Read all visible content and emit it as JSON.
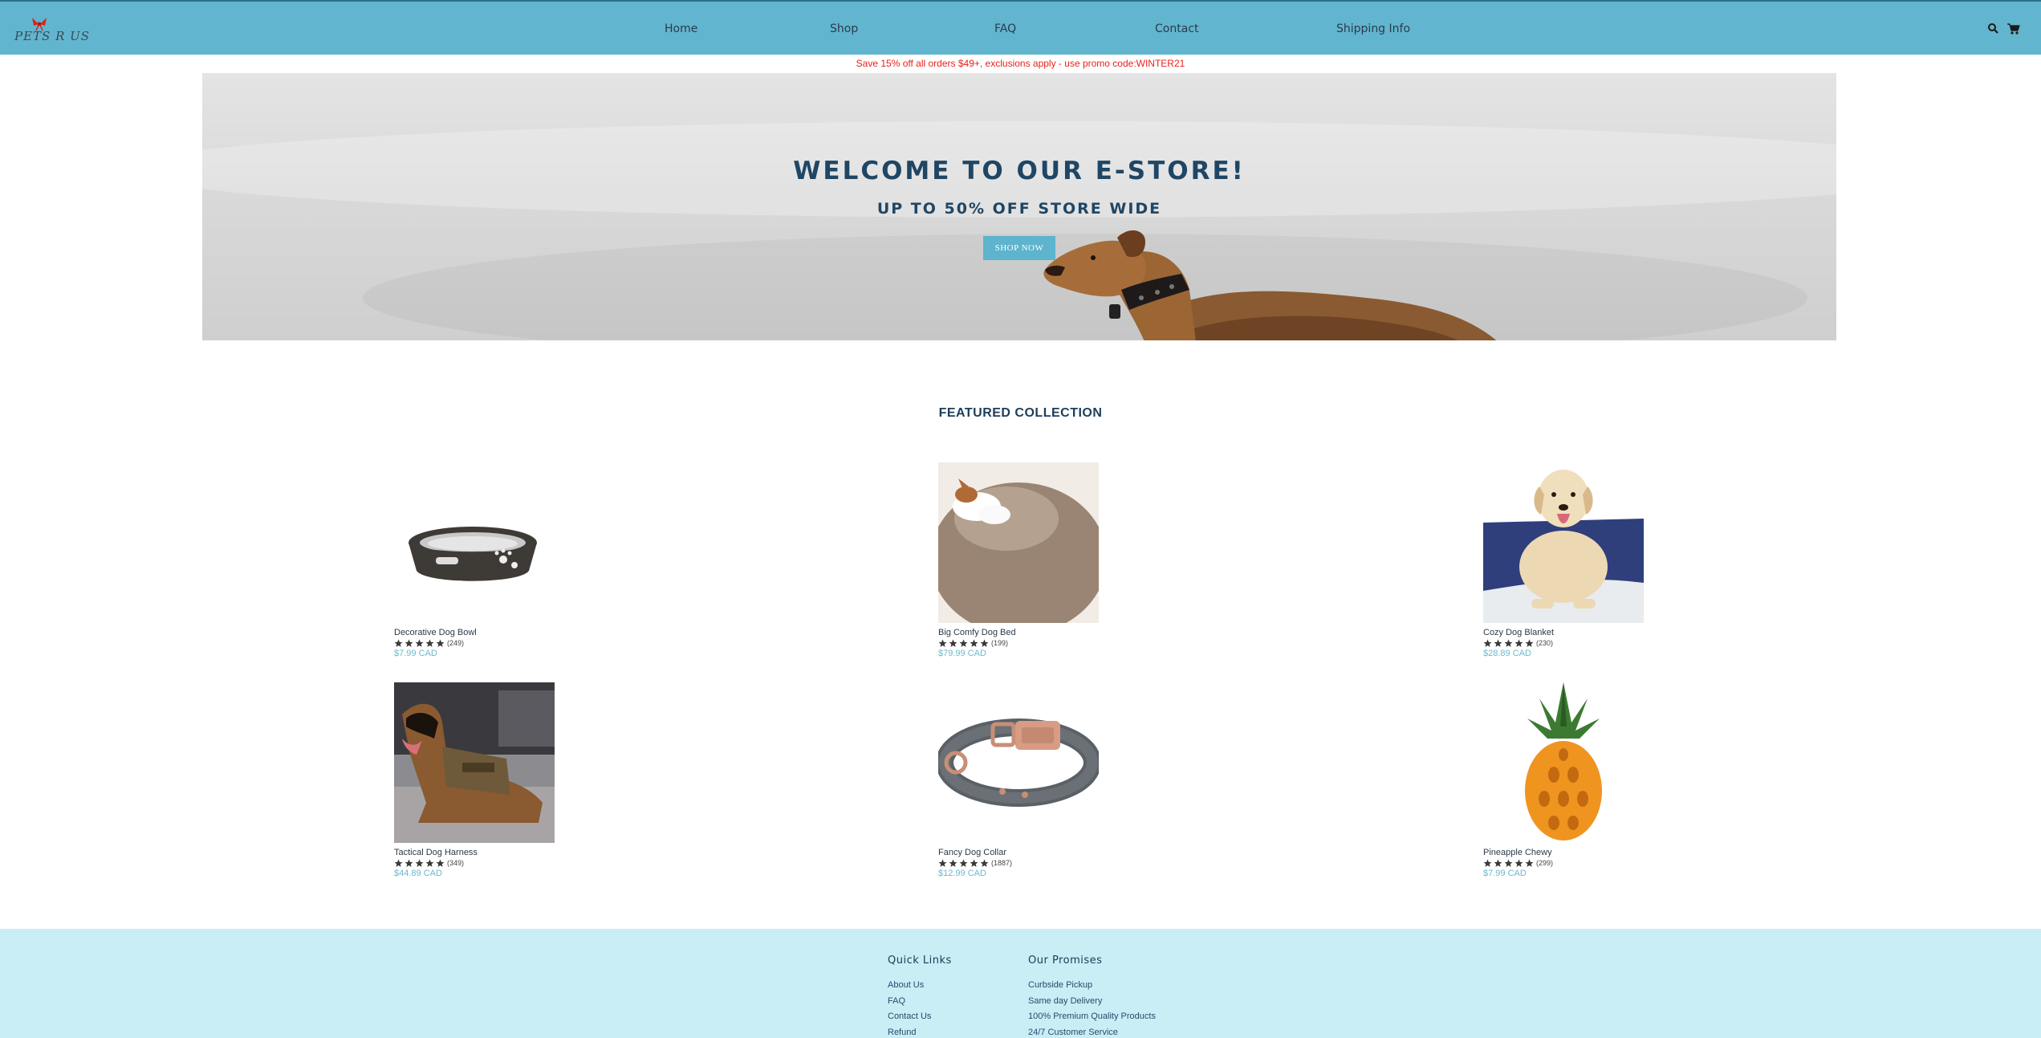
{
  "brand": {
    "logo_text": "PETS R US"
  },
  "nav": {
    "links": [
      "Home",
      "Shop",
      "FAQ",
      "Contact",
      "Shipping Info"
    ]
  },
  "promo": {
    "text": "Save 15% off all orders $49+, exclusions apply - use promo code:WINTER21",
    "color": "#e8211a"
  },
  "hero": {
    "title": "Welcome to our E-Store!",
    "subtitle": "Up to 50% off store wide",
    "button": "SHOP NOW"
  },
  "featured": {
    "title": "FEATURED COLLECTION",
    "products": [
      {
        "name": "Decorative Dog Bowl",
        "reviews": "(249)",
        "rating": 5,
        "price": "$7.99 CAD",
        "image": "dog-bowl"
      },
      {
        "name": "Big Comfy Dog Bed",
        "reviews": "(199)",
        "rating": 5,
        "price": "$79.99 CAD",
        "image": "dog-bed"
      },
      {
        "name": "Cozy Dog Blanket",
        "reviews": "(230)",
        "rating": 5,
        "price": "$28.89 CAD",
        "image": "dog-blanket"
      },
      {
        "name": "Tactical Dog Harness",
        "reviews": "(349)",
        "rating": 5,
        "price": "$44.89 CAD",
        "image": "dog-harness"
      },
      {
        "name": "Fancy Dog Collar",
        "reviews": "(1887)",
        "rating": 5,
        "price": "$12.99 CAD",
        "image": "dog-collar"
      },
      {
        "name": "Pineapple Chewy",
        "reviews": "(299)",
        "rating": 5,
        "price": "$7.99 CAD",
        "image": "pineapple-toy"
      }
    ]
  },
  "footer": {
    "quick_links": {
      "title": "Quick Links",
      "items": [
        "About Us",
        "FAQ",
        "Contact Us",
        "Refund"
      ]
    },
    "promises": {
      "title": "Our Promises",
      "items": [
        "Curbside Pickup",
        "Same day Delivery",
        "100% Premium Quality Products",
        "24/7 Customer Service"
      ]
    }
  },
  "colors": {
    "nav_bg": "#62b5ce",
    "accent": "#5db4cc",
    "price": "#6ab8d0",
    "footer_bg": "#c9eef6",
    "heading": "#1f4664"
  },
  "icons": [
    "search-icon",
    "cart-icon",
    "star-icon"
  ]
}
